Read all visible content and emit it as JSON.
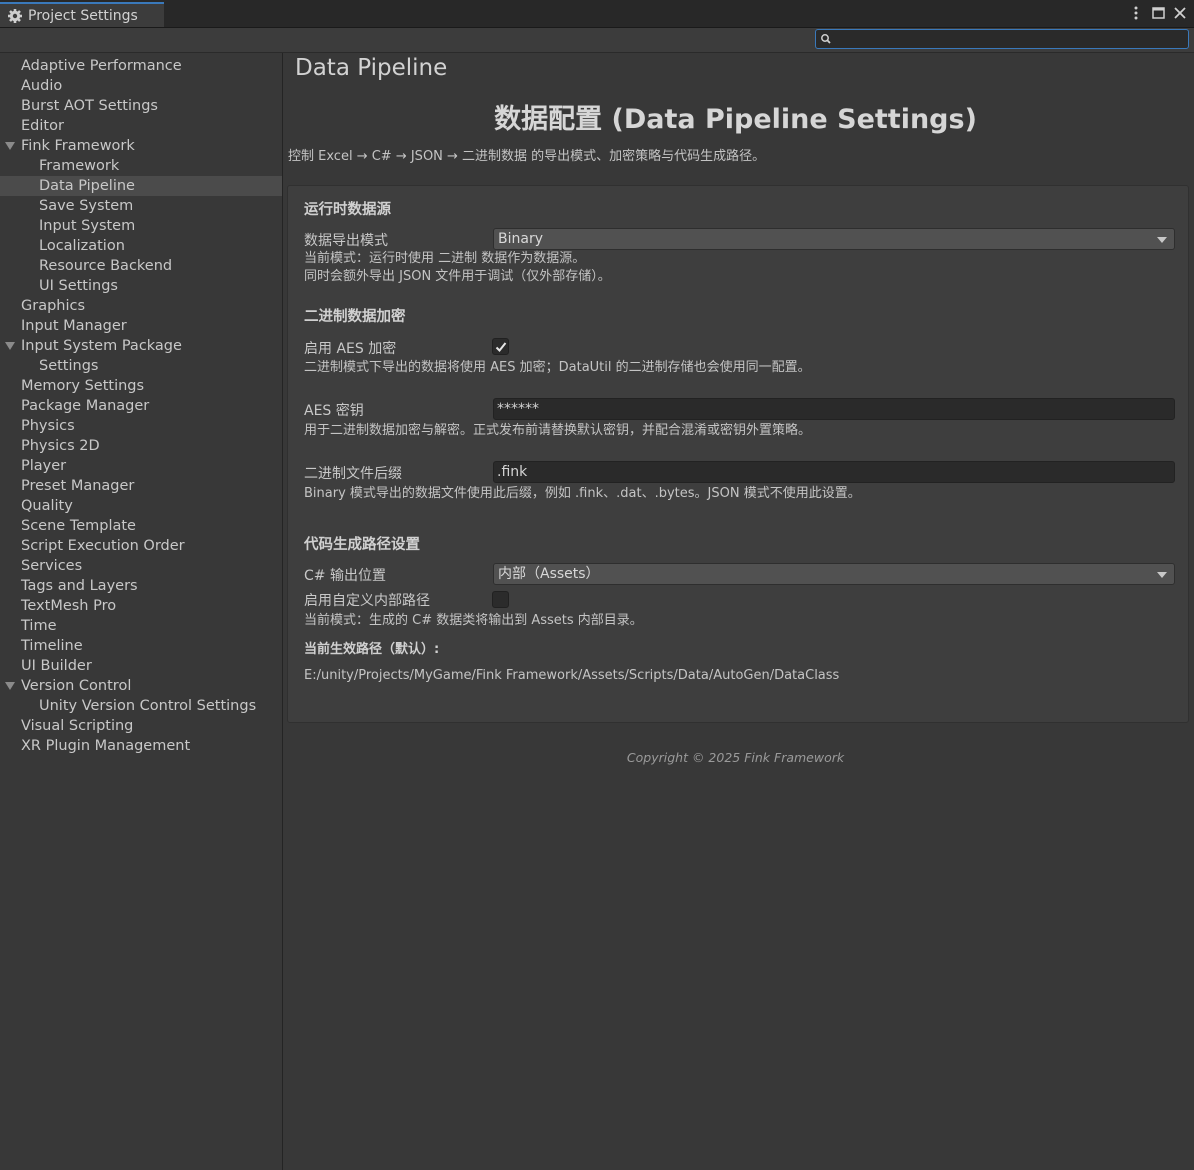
{
  "window": {
    "tab_title": "Project Settings"
  },
  "search": {
    "value": "",
    "placeholder": ""
  },
  "sidebar": {
    "items": [
      {
        "label": "Adaptive Performance"
      },
      {
        "label": "Audio"
      },
      {
        "label": "Burst AOT Settings"
      },
      {
        "label": "Editor"
      },
      {
        "label": "Fink Framework"
      },
      {
        "label": "Framework"
      },
      {
        "label": "Data Pipeline"
      },
      {
        "label": "Save System"
      },
      {
        "label": "Input System"
      },
      {
        "label": "Localization"
      },
      {
        "label": "Resource Backend"
      },
      {
        "label": "UI Settings"
      },
      {
        "label": "Graphics"
      },
      {
        "label": "Input Manager"
      },
      {
        "label": "Input System Package"
      },
      {
        "label": "Settings"
      },
      {
        "label": "Memory Settings"
      },
      {
        "label": "Package Manager"
      },
      {
        "label": "Physics"
      },
      {
        "label": "Physics 2D"
      },
      {
        "label": "Player"
      },
      {
        "label": "Preset Manager"
      },
      {
        "label": "Quality"
      },
      {
        "label": "Scene Template"
      },
      {
        "label": "Script Execution Order"
      },
      {
        "label": "Services"
      },
      {
        "label": "Tags and Layers"
      },
      {
        "label": "TextMesh Pro"
      },
      {
        "label": "Time"
      },
      {
        "label": "Timeline"
      },
      {
        "label": "UI Builder"
      },
      {
        "label": "Version Control"
      },
      {
        "label": "Unity Version Control Settings"
      },
      {
        "label": "Visual Scripting"
      },
      {
        "label": "XR Plugin Management"
      }
    ]
  },
  "main": {
    "page_title": "Data Pipeline",
    "heading": "数据配置 (Data Pipeline Settings)",
    "subtitle": "控制 Excel → C# → JSON → 二进制数据 的导出模式、加密策略与代码生成路径。",
    "runtime": {
      "group_title": "运行时数据源",
      "export_mode_label": "数据导出模式",
      "export_mode_value": "Binary",
      "help1": "当前模式：运行时使用 二进制 数据作为数据源。",
      "help2": "同时会额外导出 JSON 文件用于调试（仅外部存储）。"
    },
    "encryption": {
      "group_title": "二进制数据加密",
      "aes_enable_label": "启用 AES 加密",
      "aes_enabled": true,
      "aes_help": "二进制模式下导出的数据将使用 AES 加密；DataUtil 的二进制存储也会使用同一配置。",
      "aes_key_label": "AES 密钥",
      "aes_key_value": "******",
      "aes_key_help": "用于二进制数据加密与解密。正式发布前请替换默认密钥，并配合混淆或密钥外置策略。",
      "suffix_label": "二进制文件后缀",
      "suffix_value": ".fink",
      "suffix_help": "Binary 模式导出的数据文件使用此后缀，例如 .fink、.dat、.bytes。JSON 模式不使用此设置。"
    },
    "codegen": {
      "group_title": "代码生成路径设置",
      "output_label": "C# 输出位置",
      "output_value": "内部（Assets）",
      "custom_path_label": "启用自定义内部路径",
      "custom_path_enabled": false,
      "help": "当前模式：生成的 C# 数据类将输出到 Assets 内部目录。",
      "effective_path_label": "当前生效路径（默认）:",
      "effective_path": "E:/unity/Projects/MyGame/Fink Framework/Assets/Scripts/Data/AutoGen/DataClass"
    },
    "footer": "Copyright © 2025 Fink Framework"
  },
  "colors": {
    "accent": "#3a79bb",
    "background": "#383838",
    "panel": "#3e3e3e"
  }
}
